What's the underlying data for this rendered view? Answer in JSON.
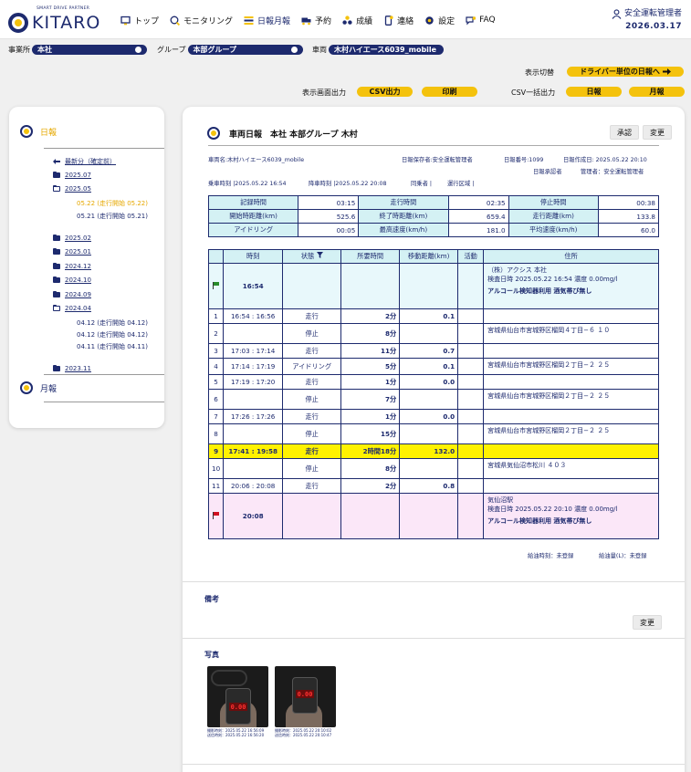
{
  "header": {
    "logo_tagline": "SMART DRIVE PARTNER",
    "logo_text": "KITARO",
    "nav": [
      {
        "label": "トップ",
        "icon": "monitor-icon"
      },
      {
        "label": "モニタリング",
        "icon": "globe-search-icon"
      },
      {
        "label": "日報月報",
        "icon": "report-list-icon"
      },
      {
        "label": "予約",
        "icon": "truck-icon"
      },
      {
        "label": "成績",
        "icon": "dots-icon"
      },
      {
        "label": "連絡",
        "icon": "phone-icon"
      },
      {
        "label": "設定",
        "icon": "gear-icon"
      },
      {
        "label": "FAQ",
        "icon": "chat-icon"
      }
    ],
    "user_name": "安全運転管理者",
    "date": "2026.03.17"
  },
  "filters": {
    "office_label": "事業所",
    "office_value": "本社",
    "group_label": "グループ",
    "group_value": "本部グループ",
    "vehicle_label": "車両",
    "vehicle_value": "木村ハイエース6039_mobile"
  },
  "options": {
    "display_switch_label": "表示切替",
    "driver_unit_button": "ドライバー単位の日報へ",
    "screen_output_label": "表示画面出力",
    "csv_output": "CSV出力",
    "print": "印刷",
    "csv_bulk_label": "CSV一括出力",
    "daily": "日報",
    "monthly": "月報"
  },
  "sidebar": {
    "daily_label": "日報",
    "monthly_label": "月報",
    "latest": "最新分（確定前）",
    "folders": [
      {
        "label": "2025.07",
        "open": false
      },
      {
        "label": "2025.05",
        "open": true,
        "children": [
          "05.22 (走行開始 05.22)",
          "05.21 (走行開始 05.21)"
        ],
        "selected": 0
      },
      {
        "label": "2025.02",
        "open": false
      },
      {
        "label": "2025.01",
        "open": false
      },
      {
        "label": "2024.12",
        "open": false
      },
      {
        "label": "2024.10",
        "open": false
      },
      {
        "label": "2024.09",
        "open": false
      },
      {
        "label": "2024.04",
        "open": true,
        "children": [
          "04.12 (走行開始 04.12)",
          "04.12 (走行開始 04.12)",
          "04.11 (走行開始 04.11)"
        ]
      },
      {
        "label": "2023.11",
        "open": false
      }
    ]
  },
  "main": {
    "title": "車両日報　本社 本部グループ 木村",
    "approve": "承認",
    "change": "変更",
    "meta": {
      "vehicle_name": "車両名:木村ハイエース6039_mobile",
      "saver": "日報保存者:安全運転管理者",
      "report_no": "日報番号:1099",
      "created": "日報作成日: 2025.05.22 20:10",
      "approver": "日報承認者",
      "manager": "管理者：安全運転管理者",
      "board_time": "乗車時刻 |2025.05.22 16:54",
      "alight_time": "降車時刻 |2025.05.22 20:08",
      "passenger": "同乗者 |",
      "route": "運行区域 |"
    },
    "summary": [
      [
        "記録時間",
        "03:15",
        "走行時間",
        "02:35",
        "停止時間",
        "00:38"
      ],
      [
        "開始時距離(km)",
        "525.6",
        "終了時距離(km)",
        "659.4",
        "走行距離(km)",
        "133.8"
      ],
      [
        "アイドリング",
        "00:05",
        "最高速度(km/h)",
        "181.0",
        "平均速度(km/h)",
        "60.0"
      ]
    ],
    "table_headers": [
      "",
      "時刻",
      "状態",
      "所要時間",
      "移動距離(km)",
      "活動",
      "住所"
    ],
    "start": {
      "time": "16:54",
      "address_line": "（株）アクシス 本社",
      "check": "検査日時 2025.05.22 16:54 濃度 0.00mg/l",
      "alcohol": "アルコール検知器利用 酒気帯び無し"
    },
    "rows": [
      {
        "no": "1",
        "time": "16:54 : 16:56",
        "status": "走行",
        "dur": "2分",
        "dist": "0.1",
        "addr": ""
      },
      {
        "no": "2",
        "time": "",
        "status": "停止",
        "dur": "8分",
        "dist": "",
        "addr": "宮城県仙台市宮城野区榴岡４丁目−６ １０"
      },
      {
        "no": "3",
        "time": "17:03 : 17:14",
        "status": "走行",
        "dur": "11分",
        "dist": "0.7",
        "addr": ""
      },
      {
        "no": "4",
        "time": "17:14 : 17:19",
        "status": "アイドリング",
        "dur": "5分",
        "dist": "0.1",
        "addr": "宮城県仙台市宮城野区榴岡２丁目−２ ２５"
      },
      {
        "no": "5",
        "time": "17:19 : 17:20",
        "status": "走行",
        "dur": "1分",
        "dist": "0.0",
        "addr": ""
      },
      {
        "no": "6",
        "time": "",
        "status": "停止",
        "dur": "7分",
        "dist": "",
        "addr": "宮城県仙台市宮城野区榴岡２丁目−２ ２５"
      },
      {
        "no": "7",
        "time": "17:26 : 17:26",
        "status": "走行",
        "dur": "1分",
        "dist": "0.0",
        "addr": ""
      },
      {
        "no": "8",
        "time": "",
        "status": "停止",
        "dur": "15分",
        "dist": "",
        "addr": "宮城県仙台市宮城野区榴岡２丁目−２ ２５"
      },
      {
        "no": "9",
        "time": "17:41 : 19:58",
        "status": "走行",
        "dur": "2時間18分",
        "dist": "132.0",
        "addr": "",
        "highlight": true
      },
      {
        "no": "10",
        "time": "",
        "status": "停止",
        "dur": "8分",
        "dist": "",
        "addr": "宮城県気仙沼市松川 ４０３"
      },
      {
        "no": "11",
        "time": "20:06 : 20:08",
        "status": "走行",
        "dur": "2分",
        "dist": "0.8",
        "addr": ""
      }
    ],
    "end": {
      "time": "20:08",
      "address_line": "気仙沼駅",
      "check": "検査日時 2025.05.22 20:10 濃度 0.00mg/l",
      "alcohol": "アルコール検知器利用 酒気帯び無し"
    },
    "fuel_time": "給油時刻：未登録",
    "fuel_amount": "給油量(L)：未登録",
    "remarks_label": "備考",
    "remarks_change": "変更",
    "photos_label": "写真",
    "photos": [
      {
        "reading": "0.00",
        "cap1": "撮影時刻：2025.05.22 16:56:09",
        "cap2": "送信時刻：2025.05.22 16:56:20"
      },
      {
        "reading": "0.00",
        "cap1": "撮影時刻：2025.05.22 20:10:02",
        "cap2": "送信時刻：2025.05.22 20:10:47"
      }
    ]
  }
}
